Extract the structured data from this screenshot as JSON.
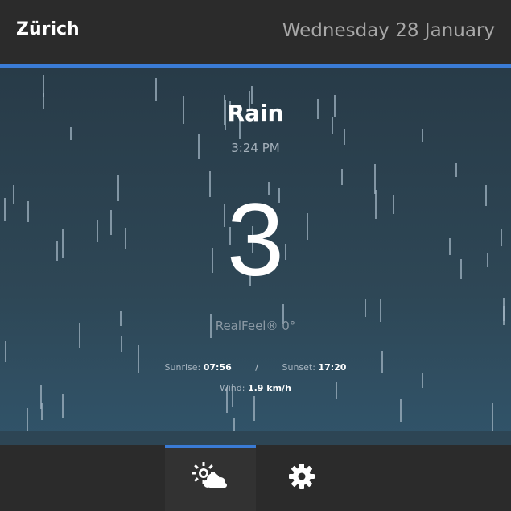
{
  "header": {
    "city": "Zürich",
    "date": "Wednesday 28 January"
  },
  "weather": {
    "condition": "Rain",
    "time": "3:24 PM",
    "temperature": "3",
    "realfeel": "RealFeel® 0°",
    "sunrise_label": "Sunrise:",
    "sunrise_value": "07:56",
    "separator": "/",
    "sunset_label": "Sunset:",
    "sunset_value": "17:20",
    "wind_label": "Wind:",
    "wind_value": "1.9 km/h"
  },
  "footer": {
    "tabs": [
      {
        "icon": "weather-sun-cloud-icon",
        "active": true
      },
      {
        "icon": "gear-icon",
        "active": false
      }
    ]
  },
  "colors": {
    "accent": "#3a7bd5",
    "header_bg": "#2b2b2b",
    "sky_top": "#283b48",
    "sky_bottom": "#31546a"
  }
}
